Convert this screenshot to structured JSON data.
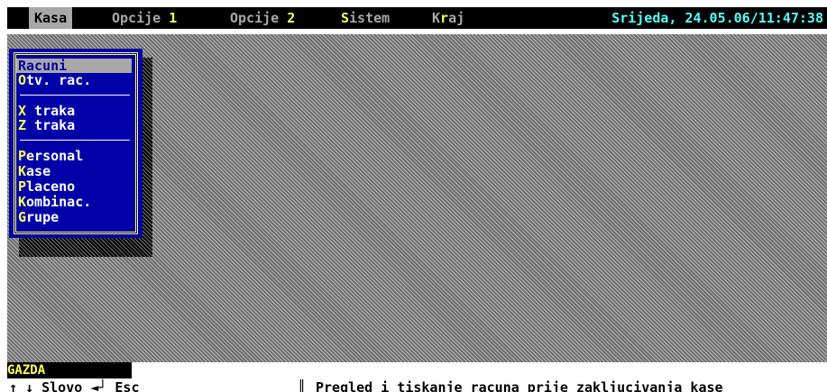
{
  "menubar": {
    "items": [
      {
        "pre": "",
        "hot": "",
        "post": "Kasa"
      },
      {
        "pre": "Opcije ",
        "hot": "1",
        "post": ""
      },
      {
        "pre": "Opcije ",
        "hot": "2",
        "post": ""
      },
      {
        "pre": "",
        "hot": "S",
        "post": "istem"
      },
      {
        "pre": "K",
        "hot": "r",
        "post": "aj"
      }
    ],
    "clock": "Srijeda, 24.05.06/11:47:38"
  },
  "menu": {
    "items": [
      {
        "hot": "",
        "rest": "Racuni"
      },
      {
        "hot": "O",
        "rest": "tv. rac."
      },
      {
        "hot": "X",
        "rest": " traka"
      },
      {
        "hot": "Z",
        "rest": " traka"
      },
      {
        "hot": "P",
        "rest": "ersonal"
      },
      {
        "hot": "K",
        "rest": "ase"
      },
      {
        "hot": "P",
        "rest": "laceno"
      },
      {
        "hot": "K",
        "rest": "ombinac."
      },
      {
        "hot": "G",
        "rest": "rupe"
      }
    ]
  },
  "user": "GAZDA",
  "statusbar": {
    "keys": "↑ ↓ Slovo ◄┘ Esc",
    "divider": "║",
    "hint": "Pregled i tiskanje racuna prije zakljucivanja kase"
  },
  "colors": {
    "menubar_bg": "#000000",
    "menu_bg": "#0000a8",
    "hotkey": "#ffff55",
    "clock": "#55ffff",
    "selection": "#a8a8a8"
  }
}
